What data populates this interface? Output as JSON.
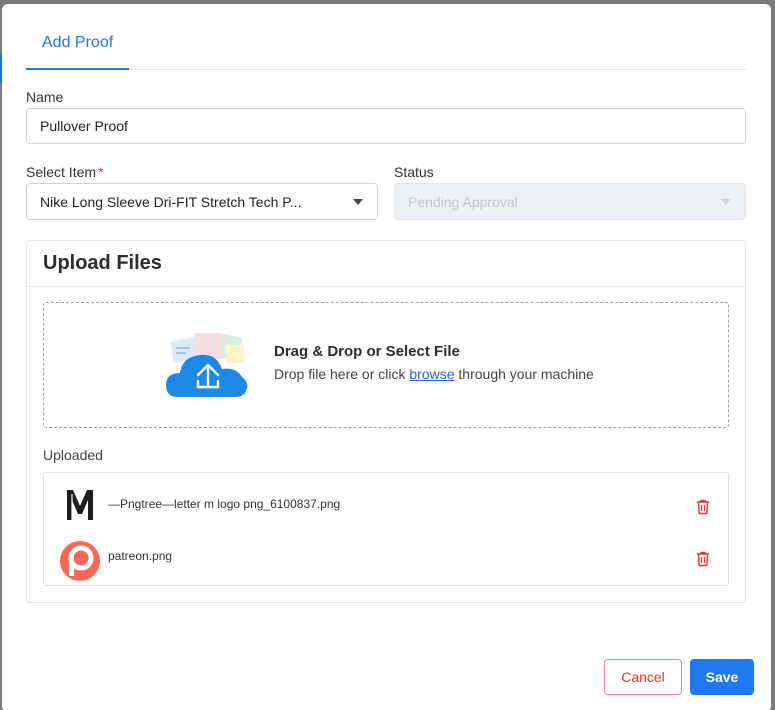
{
  "modal": {
    "tab_label": "Add Proof"
  },
  "form": {
    "name_label": "Name",
    "name_value": "Pullover Proof",
    "item_label": "Select Item",
    "item_required_mark": "*",
    "item_value": "Nike Long Sleeve Dri-FIT Stretch Tech P...",
    "status_label": "Status",
    "status_value": "Pending Approval"
  },
  "upload": {
    "card_title": "Upload Files",
    "dropzone_title": "Drag & Drop or Select File",
    "dropzone_sub_before": "Drop file here or click",
    "dropzone_link": "browse",
    "dropzone_sub_after": "through your machine",
    "uploaded_label": "Uploaded",
    "files": [
      {
        "name": "—Pngtree—letter m logo png_6100837.png",
        "icon": "letter-m-logo-icon"
      },
      {
        "name": "patreon.png",
        "icon": "patreon-logo-icon"
      }
    ]
  },
  "footer": {
    "cancel_label": "Cancel",
    "save_label": "Save"
  },
  "colors": {
    "primary": "#1f78f2",
    "danger": "#e3342f",
    "patreon": "#f96854"
  }
}
